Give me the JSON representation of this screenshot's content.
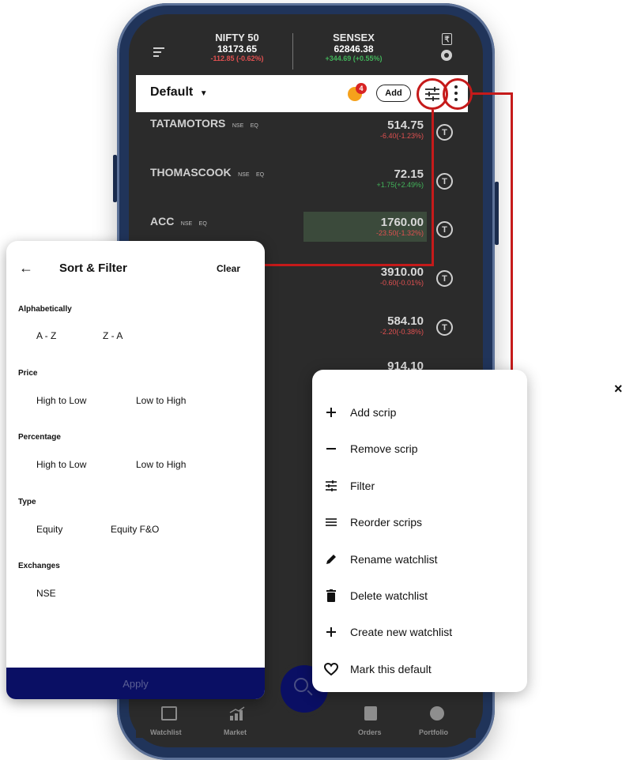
{
  "header": {
    "nifty": {
      "name": "NIFTY 50",
      "value": "18173.65",
      "change": "-112.85 (-0.62%)"
    },
    "sensex": {
      "name": "SENSEX",
      "value": "62846.38",
      "change": "+344.69 (+0.55%)"
    }
  },
  "watchlist": {
    "title": "Default",
    "badge_count": "4",
    "add_label": "Add"
  },
  "scrips": [
    {
      "name": "TATAMOTORS",
      "exchange": "NSE",
      "segment": "EQ",
      "price": "514.75",
      "change": "-6.40(-1.23%)",
      "icon": "T"
    },
    {
      "name": "THOMASCOOK",
      "exchange": "NSE",
      "segment": "EQ",
      "price": "72.15",
      "change": "+1.75(+2.49%)",
      "icon": "T"
    },
    {
      "name": "ACC",
      "exchange": "NSE",
      "segment": "EQ",
      "price": "1760.00",
      "change": "-23.50(-1.32%)",
      "icon": "T"
    },
    {
      "price": "3910.00",
      "change": "-0.60(-0.01%)",
      "icon": "T"
    },
    {
      "price": "584.10",
      "change": "-2.20(-0.38%)",
      "icon": "T"
    },
    {
      "price": "914.10"
    }
  ],
  "sort_filter": {
    "title": "Sort & Filter",
    "clear": "Clear",
    "alphabetically": {
      "label": "Alphabetically",
      "options": [
        "A - Z",
        "Z - A"
      ]
    },
    "price": {
      "label": "Price",
      "options": [
        "High to Low",
        "Low to High"
      ]
    },
    "percentage": {
      "label": "Percentage",
      "options": [
        "High to Low",
        "Low to High"
      ]
    },
    "type": {
      "label": "Type",
      "options": [
        "Equity",
        "Equity F&O"
      ]
    },
    "exchanges": {
      "label": "Exchanges",
      "options": [
        "NSE"
      ]
    },
    "apply": "Apply"
  },
  "menu": {
    "items": [
      {
        "label": "Add scrip",
        "icon": "plus-icon"
      },
      {
        "label": "Remove scrip",
        "icon": "minus-icon"
      },
      {
        "label": "Filter",
        "icon": "filter-icon"
      },
      {
        "label": "Reorder scrips",
        "icon": "reorder-icon"
      },
      {
        "label": "Rename watchlist",
        "icon": "pencil-icon"
      },
      {
        "label": "Delete watchlist",
        "icon": "trash-icon"
      },
      {
        "label": "Create new watchlist",
        "icon": "plus-icon"
      },
      {
        "label": "Mark this default",
        "icon": "heart-icon"
      }
    ]
  },
  "bottom_nav": [
    "Watchlist",
    "Market",
    "Orders",
    "Portfolio"
  ],
  "close_glyph": "×",
  "colors": {
    "highlight_red": "#c51a1a",
    "apply_bg": "#0a0f64",
    "negative": "#e05050",
    "positive": "#42b35a"
  }
}
